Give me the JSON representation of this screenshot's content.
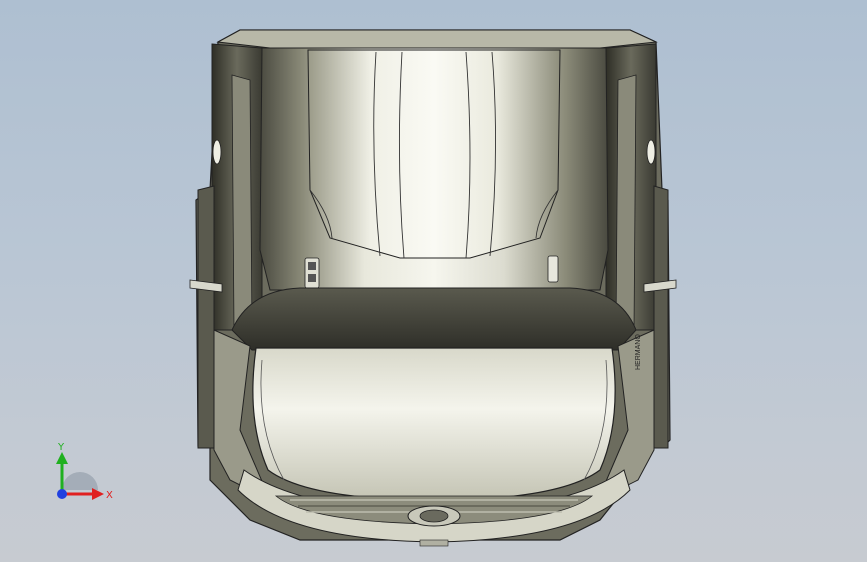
{
  "viewport": {
    "background_top": "#aebfd1",
    "background_bottom": "#c7cbd1"
  },
  "model": {
    "body_color": "#c8c8b8",
    "dark_color": "#3c3c34",
    "emblem_text": "HERMANO"
  },
  "triad": {
    "x_label": "X",
    "y_label": "Y",
    "x_color": "#e02020",
    "y_color": "#20b020",
    "z_color": "#2040e0"
  }
}
